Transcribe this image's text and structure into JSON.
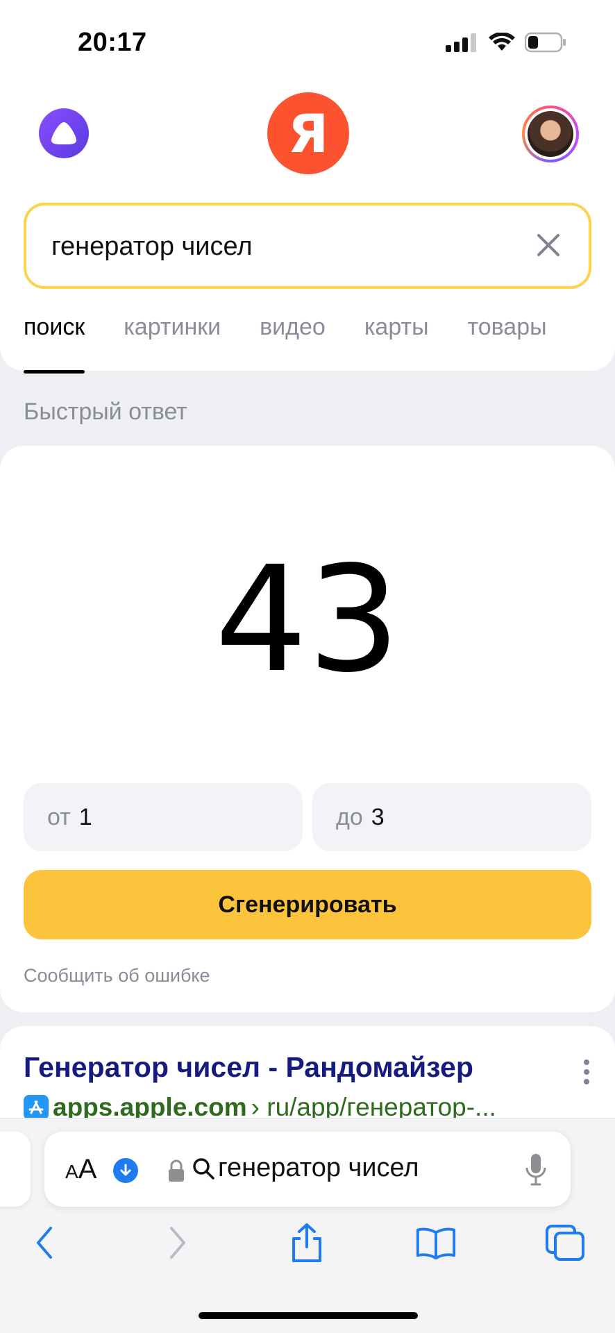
{
  "status": {
    "time": "20:17"
  },
  "header": {
    "logo_letter": "Я"
  },
  "search": {
    "query": "генератор чисел"
  },
  "tabs": [
    {
      "label": "поиск"
    },
    {
      "label": "картинки"
    },
    {
      "label": "видео"
    },
    {
      "label": "карты"
    },
    {
      "label": "товары"
    }
  ],
  "quick_answer": {
    "label": "Быстрый ответ",
    "result": "43",
    "from_label": "от",
    "from_value": "1",
    "to_label": "до",
    "to_value": "3",
    "button": "Сгенерировать",
    "report": "Сообщить об ошибке"
  },
  "result": {
    "title": "Генератор чисел - Рандомайзер",
    "domain": "apps.apple.com",
    "path": "› ru/app/генератор-..."
  },
  "safari": {
    "text_size": "AA",
    "url_text": "генератор чисел"
  },
  "colors": {
    "accent": "#fcc43d",
    "yandex_red": "#fc5230",
    "link": "#161b80",
    "url_green": "#2e6b1e",
    "ios_blue": "#1e7cf0"
  }
}
